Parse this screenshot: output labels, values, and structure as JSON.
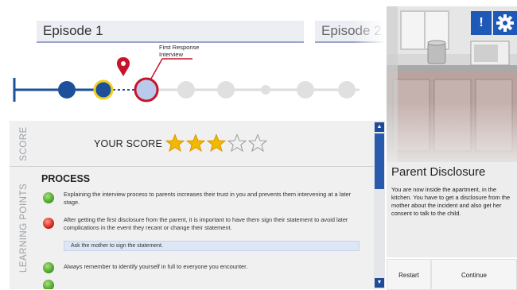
{
  "episodes": {
    "tabs": [
      "Episode 1",
      "Episode 2"
    ],
    "marker_label": "First Response Interview"
  },
  "score": {
    "side_label": "SCORE",
    "label": "YOUR SCORE",
    "rating": 3,
    "max": 5
  },
  "learning_points": {
    "side_label": "LEARNING POINTS",
    "section_title": "PROCESS",
    "items": [
      {
        "status": "good",
        "text": "Explaining the interview process to parents increases their trust in you and prevents them intervening at a later stage."
      },
      {
        "status": "bad",
        "text": "After getting the first disclosure from the parent, it is important to have them sign their statement to avoid later complications in the event they recant or change their statement.",
        "hint": "Ask the mother to sign the statement."
      },
      {
        "status": "good",
        "text": "Always remember to identify yourself in full to everyone you encounter."
      }
    ]
  },
  "scene": {
    "title": "Parent Disclosure",
    "description": "You are now inside the apartment, in the kitchen. You have to get a disclosure from the mother about the incident and also get her consent to talk to the child.",
    "restart_label": "Restart",
    "continue_label": "Continue",
    "alert_label": "!"
  },
  "colors": {
    "accent": "#1f59b8",
    "timeline_node": "#1d4f9a",
    "current_ring": "#c8142a",
    "star_gold": "#f3b800"
  }
}
